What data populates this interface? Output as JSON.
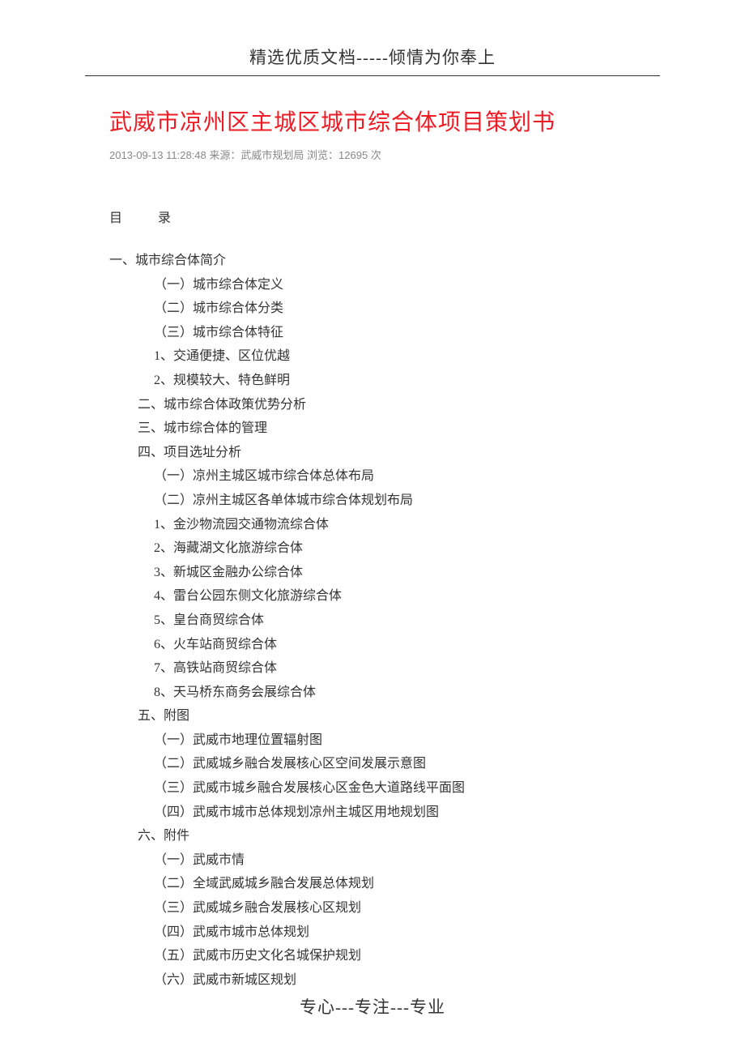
{
  "header": "精选优质文档-----倾情为你奉上",
  "title": "武威市凉州区主城区城市综合体项目策划书",
  "meta": {
    "datetime": "2013-09-13 11:28:48",
    "source_label": "来源：",
    "source_value": "武威市规划局",
    "views_label": "浏览：",
    "views_value": "12695",
    "views_unit": "次"
  },
  "toc_heading": "目　　录",
  "toc": [
    {
      "level": 1,
      "text": "一、城市综合体简介"
    },
    {
      "level": 3,
      "text": "（一）城市综合体定义"
    },
    {
      "level": 3,
      "text": "（二）城市综合体分类"
    },
    {
      "level": 3,
      "text": "（三）城市综合体特征"
    },
    {
      "level": 3,
      "text": "1、交通便捷、区位优越"
    },
    {
      "level": 3,
      "text": "2、规模较大、特色鲜明"
    },
    {
      "level": 2,
      "text": "二、城市综合体政策优势分析"
    },
    {
      "level": 2,
      "text": "三、城市综合体的管理"
    },
    {
      "level": 2,
      "text": "四、项目选址分析"
    },
    {
      "level": 3,
      "text": "（一）凉州主城区城市综合体总体布局"
    },
    {
      "level": 3,
      "text": "（二）凉州主城区各单体城市综合体规划布局"
    },
    {
      "level": 3,
      "text": "1、金沙物流园交通物流综合体"
    },
    {
      "level": 3,
      "text": "2、海藏湖文化旅游综合体"
    },
    {
      "level": 3,
      "text": "3、新城区金融办公综合体"
    },
    {
      "level": 3,
      "text": "4、雷台公园东侧文化旅游综合体"
    },
    {
      "level": 3,
      "text": "5、皇台商贸综合体"
    },
    {
      "level": 3,
      "text": "6、火车站商贸综合体"
    },
    {
      "level": 3,
      "text": "7、高铁站商贸综合体"
    },
    {
      "level": 3,
      "text": "8、天马桥东商务会展综合体"
    },
    {
      "level": 2,
      "text": "五、附图"
    },
    {
      "level": 3,
      "text": "（一）武威市地理位置辐射图"
    },
    {
      "level": 3,
      "text": "（二）武威城乡融合发展核心区空间发展示意图"
    },
    {
      "level": 3,
      "text": "（三）武威市城乡融合发展核心区金色大道路线平面图"
    },
    {
      "level": 3,
      "text": "（四）武威市城市总体规划凉州主城区用地规划图"
    },
    {
      "level": 2,
      "text": "六、附件"
    },
    {
      "level": 3,
      "text": "（一）武威市情"
    },
    {
      "level": 3,
      "text": "（二）全域武威城乡融合发展总体规划"
    },
    {
      "level": 3,
      "text": "（三）武威城乡融合发展核心区规划"
    },
    {
      "level": 3,
      "text": "（四）武威市城市总体规划"
    },
    {
      "level": 3,
      "text": "（五）武威市历史文化名城保护规划"
    },
    {
      "level": 3,
      "text": "（六）武威市新城区规划"
    }
  ],
  "footer": "专心---专注---专业"
}
